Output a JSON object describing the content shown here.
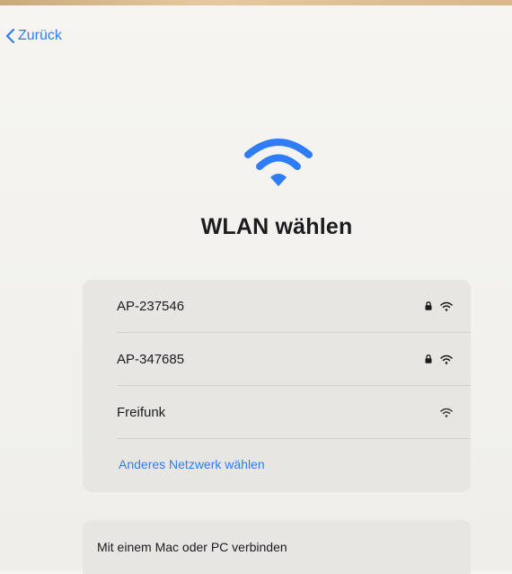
{
  "nav": {
    "back_label": "Zurück"
  },
  "header": {
    "icon": "wifi-icon",
    "title": "WLAN wählen"
  },
  "networks": [
    {
      "name": "AP-237546",
      "secured": true,
      "signal": "wifi-icon"
    },
    {
      "name": "AP-347685",
      "secured": true,
      "signal": "wifi-icon"
    },
    {
      "name": "Freifunk",
      "secured": false,
      "signal": "wifi-icon"
    }
  ],
  "other_network_label": "Anderes Netzwerk wählen",
  "connect_mac_pc_label": "Mit einem Mac oder PC verbinden",
  "colors": {
    "accent": "#2f7df6",
    "card": "#e7e6e3",
    "background": "#f4f3ef"
  }
}
